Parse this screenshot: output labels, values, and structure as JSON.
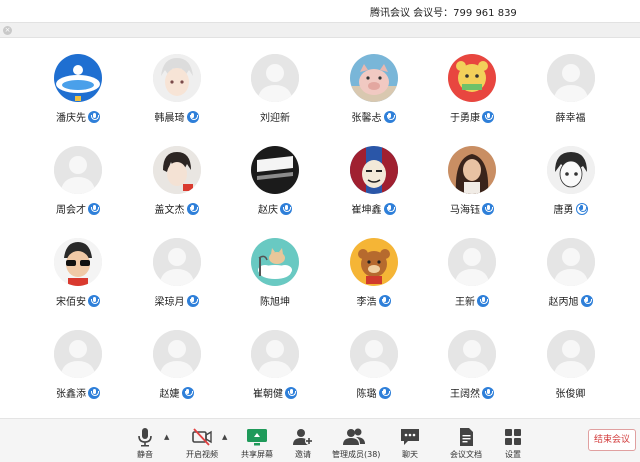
{
  "window": {
    "title": "腾讯会议 会议号：799 961 839"
  },
  "subbar": {
    "close_glyph": "×"
  },
  "participants": [
    {
      "name": "潘庆先",
      "mic": "muted",
      "avatar": "globe"
    },
    {
      "name": "韩晨琦",
      "mic": "muted",
      "avatar": "anime-white-hair"
    },
    {
      "name": "刘迎新",
      "mic": "none",
      "avatar": "default"
    },
    {
      "name": "张馨忐",
      "mic": "muted",
      "avatar": "pig"
    },
    {
      "name": "于勇康",
      "mic": "muted",
      "avatar": "cartoon-bear"
    },
    {
      "name": "薛幸福",
      "mic": "none",
      "avatar": "default"
    },
    {
      "name": "周会才",
      "mic": "muted",
      "avatar": "default"
    },
    {
      "name": "盖文杰",
      "mic": "muted",
      "avatar": "anime-dark-hair"
    },
    {
      "name": "赵庆",
      "mic": "muted",
      "avatar": "dark-screen"
    },
    {
      "name": "崔坤鑫",
      "mic": "muted",
      "avatar": "meme-face"
    },
    {
      "name": "马海钰",
      "mic": "muted",
      "avatar": "girl-photo"
    },
    {
      "name": "唐勇",
      "mic": "active",
      "avatar": "anime-boy"
    },
    {
      "name": "宋佰安",
      "mic": "muted",
      "avatar": "kid-sunglasses"
    },
    {
      "name": "梁琼月",
      "mic": "muted",
      "avatar": "default"
    },
    {
      "name": "陈旭坤",
      "mic": "none",
      "avatar": "cat-cloud"
    },
    {
      "name": "李浩",
      "mic": "muted",
      "avatar": "teddy-bear"
    },
    {
      "name": "王新",
      "mic": "muted",
      "avatar": "default"
    },
    {
      "name": "赵丙旭",
      "mic": "muted",
      "avatar": "default"
    },
    {
      "name": "张鑫添",
      "mic": "muted",
      "avatar": "default"
    },
    {
      "name": "赵婕",
      "mic": "muted",
      "avatar": "default"
    },
    {
      "name": "崔朝健",
      "mic": "muted",
      "avatar": "default"
    },
    {
      "name": "陈璐",
      "mic": "muted",
      "avatar": "default"
    },
    {
      "name": "王阔然",
      "mic": "muted",
      "avatar": "default"
    },
    {
      "name": "张俊卿",
      "mic": "none",
      "avatar": "default"
    }
  ],
  "toolbar": {
    "mute": "静音",
    "video": "开启视频",
    "share": "共享屏幕",
    "invite": "邀请",
    "manage": "管理成员(38)",
    "chat": "聊天",
    "docs": "会议文档",
    "settings": "设置",
    "end": "结束会议",
    "caret": "▲"
  },
  "colors": {
    "accent": "#2e7fd9",
    "end": "#d23b3b",
    "share": "#1f9a5a"
  }
}
